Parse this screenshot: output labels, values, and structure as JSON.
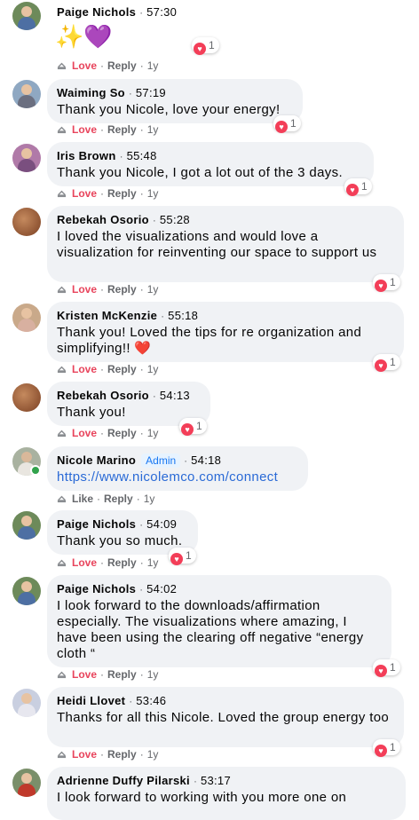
{
  "comments": [
    {
      "name": "Paige Nichols",
      "time": "57:30",
      "text": "✨💜",
      "react_count": "1",
      "love": "Love",
      "reply": "Reply",
      "age": "1y"
    },
    {
      "name": "Waiming So",
      "time": "57:19",
      "text": "Thank you Nicole, love your energy!",
      "react_count": "1",
      "love": "Love",
      "reply": "Reply",
      "age": "1y"
    },
    {
      "name": "Iris Brown",
      "time": "55:48",
      "text": "Thank you Nicole, I got a lot out of the 3 days.",
      "react_count": "1",
      "love": "Love",
      "reply": "Reply",
      "age": "1y"
    },
    {
      "name": "Rebekah Osorio",
      "time": "55:28",
      "text": "I loved the visualizations and would love a visualization for reinventing our space to support us",
      "react_count": "1",
      "love": "Love",
      "reply": "Reply",
      "age": "1y"
    },
    {
      "name": "Kristen McKenzie",
      "time": "55:18",
      "text": "Thank you! Loved the tips for re organization and simplifying!! ❤️",
      "react_count": "1",
      "love": "Love",
      "reply": "Reply",
      "age": "1y"
    },
    {
      "name": "Rebekah Osorio",
      "time": "54:13",
      "text": "Thank you!",
      "react_count": "1",
      "love": "Love",
      "reply": "Reply",
      "age": "1y"
    },
    {
      "name": "Nicole Marino",
      "badge": "Admin",
      "time": "54:18",
      "text": "https://www.nicolemco.com/connect",
      "like": "Like",
      "reply": "Reply",
      "age": "1y"
    },
    {
      "name": "Paige Nichols",
      "time": "54:09",
      "text": "Thank you so much.",
      "react_count": "1",
      "love": "Love",
      "reply": "Reply",
      "age": "1y"
    },
    {
      "name": "Paige Nichols",
      "time": "54:02",
      "text": "I look forward to the downloads/affirmation especially. The visualizations where amazing, I have been using the clearing off negative “energy cloth “",
      "react_count": "1",
      "love": "Love",
      "reply": "Reply",
      "age": "1y"
    },
    {
      "name": "Heidi Llovet",
      "time": "53:46",
      "text": "Thanks for all this Nicole. Loved the group energy too",
      "react_count": "1",
      "love": "Love",
      "reply": "Reply",
      "age": "1y"
    },
    {
      "name": "Adrienne Duffy Pilarski",
      "time": "53:17",
      "text": "I look forward to working with you more one on"
    }
  ],
  "colors": {
    "love": "#e8445c",
    "bubble": "#f0f2f5",
    "link": "#2a6ad6",
    "admin": "#1877f2"
  }
}
